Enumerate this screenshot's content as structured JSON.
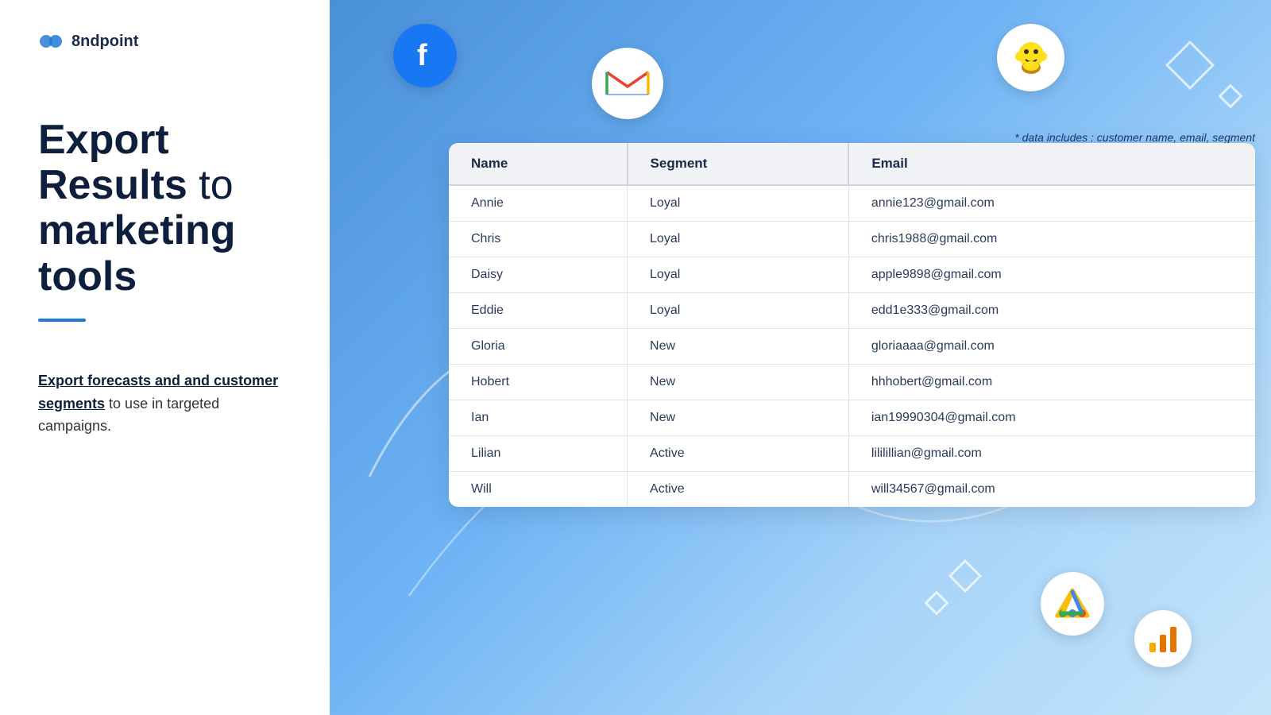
{
  "logo": {
    "text": "8ndpoint"
  },
  "left": {
    "headline_line1": "Export",
    "headline_line2": "Results",
    "headline_suffix": " to",
    "headline_line3": "marketing tools",
    "description_bold": "Export forecasts and and customer segments",
    "description_rest": " to use in targeted campaigns."
  },
  "data_note": "* data includes : customer name, email, segment",
  "table": {
    "headers": [
      "Name",
      "Segment",
      "Email"
    ],
    "rows": [
      [
        "Annie",
        "Loyal",
        "annie123@gmail.com"
      ],
      [
        "Chris",
        "Loyal",
        "chris1988@gmail.com"
      ],
      [
        "Daisy",
        "Loyal",
        "apple9898@gmail.com"
      ],
      [
        "Eddie",
        "Loyal",
        "edd1e333@gmail.com"
      ],
      [
        "Gloria",
        "New",
        "gloriaaaa@gmail.com"
      ],
      [
        "Hobert",
        "New",
        "hhhobert@gmail.com"
      ],
      [
        "Ian",
        "New",
        "ian19990304@gmail.com"
      ],
      [
        "Lilian",
        "Active",
        "lililillian@gmail.com"
      ],
      [
        "Will",
        "Active",
        "will34567@gmail.com"
      ]
    ]
  },
  "icons": {
    "facebook_letter": "f",
    "gmail_letter": "M",
    "mailchimp_label": "🐵",
    "google_ads_label": "A",
    "analytics_label": "📊"
  }
}
